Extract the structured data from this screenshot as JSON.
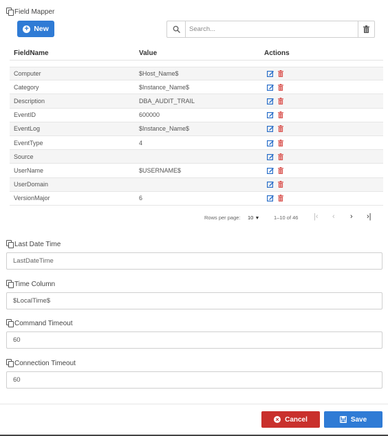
{
  "section": {
    "title": "Field Mapper"
  },
  "toolbar": {
    "new_label": "New",
    "search_placeholder": "Search..."
  },
  "grid": {
    "columns": [
      "FieldName",
      "Value",
      "Actions"
    ],
    "rows": [
      {
        "field": "Computer",
        "value": "$Host_Name$"
      },
      {
        "field": "Category",
        "value": "$Instance_Name$"
      },
      {
        "field": "Description",
        "value": "DBA_AUDIT_TRAIL"
      },
      {
        "field": "EventID",
        "value": "600000"
      },
      {
        "field": "EventLog",
        "value": "$Instance_Name$"
      },
      {
        "field": "EventType",
        "value": "4"
      },
      {
        "field": "Source",
        "value": ""
      },
      {
        "field": "UserName",
        "value": "$USERNAME$"
      },
      {
        "field": "UserDomain",
        "value": ""
      },
      {
        "field": "VersionMajor",
        "value": "6"
      }
    ]
  },
  "pagination": {
    "rows_per_page_label": "Rows per page:",
    "rows_per_page": "10",
    "range": "1–10 of 46"
  },
  "fields": {
    "last_date_time": {
      "label": "Last Date Time",
      "placeholder": "LastDateTime",
      "value": ""
    },
    "time_column": {
      "label": "Time Column",
      "value": "$LocalTime$"
    },
    "command_timeout": {
      "label": "Command Timeout",
      "value": "60"
    },
    "connection_timeout": {
      "label": "Connection Timeout",
      "value": "60"
    }
  },
  "footer": {
    "cancel_label": "Cancel",
    "save_label": "Save"
  },
  "colors": {
    "primary": "#2f7bd5",
    "danger": "#c9302c",
    "edit_icon": "#2a6fc9",
    "delete_icon": "#d9534f"
  },
  "icons": [
    "copy-icon",
    "plus-circle-icon",
    "search-icon",
    "trash-icon",
    "edit-icon",
    "delete-icon",
    "first-page-icon",
    "prev-page-icon",
    "next-page-icon",
    "last-page-icon",
    "times-circle-icon",
    "floppy-icon"
  ]
}
